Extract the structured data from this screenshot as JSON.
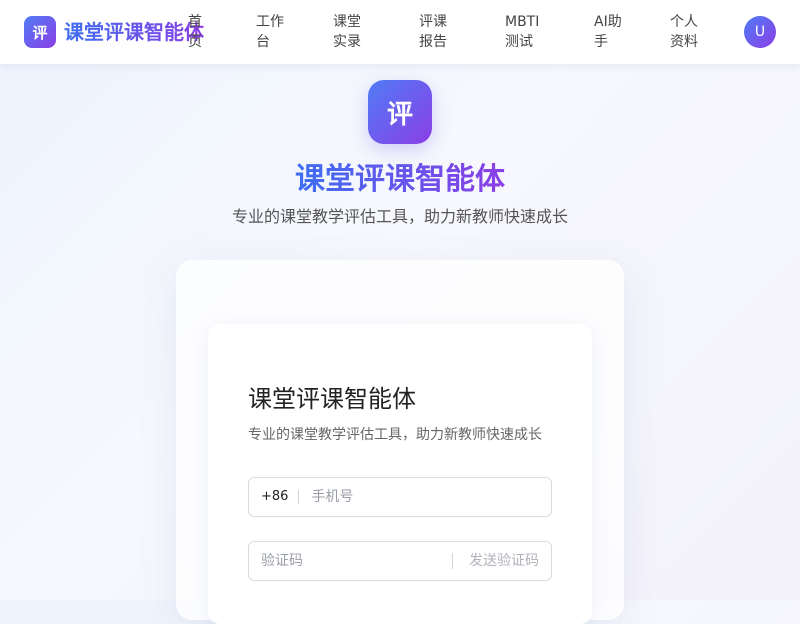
{
  "navbar": {
    "logo_glyph": "评",
    "brand_name": "课堂评课智能体",
    "items": [
      {
        "line1": "首",
        "line2": "页"
      },
      {
        "line1": "工作",
        "line2": "台"
      },
      {
        "line1": "课堂",
        "line2": "实录"
      },
      {
        "line1": "评课",
        "line2": "报告"
      },
      {
        "line1": "MBTI",
        "line2": "测试"
      },
      {
        "line1": "AI助",
        "line2": "手"
      },
      {
        "line1": "个人",
        "line2": "资料"
      }
    ],
    "avatar_initial": "U"
  },
  "hero": {
    "logo_glyph": "评",
    "title": "课堂评课智能体",
    "subtitle": "专业的课堂教学评估工具，助力新教师快速成长"
  },
  "login_form": {
    "title": "课堂评课智能体",
    "subtitle": "专业的课堂教学评估工具，助力新教师快速成长",
    "phone_prefix": "+86",
    "phone_placeholder": "手机号",
    "code_placeholder": "验证码",
    "send_code_label": "发送验证码"
  },
  "colors": {
    "accent_start": "#4f7cf6",
    "accent_end": "#8b3ee6"
  }
}
